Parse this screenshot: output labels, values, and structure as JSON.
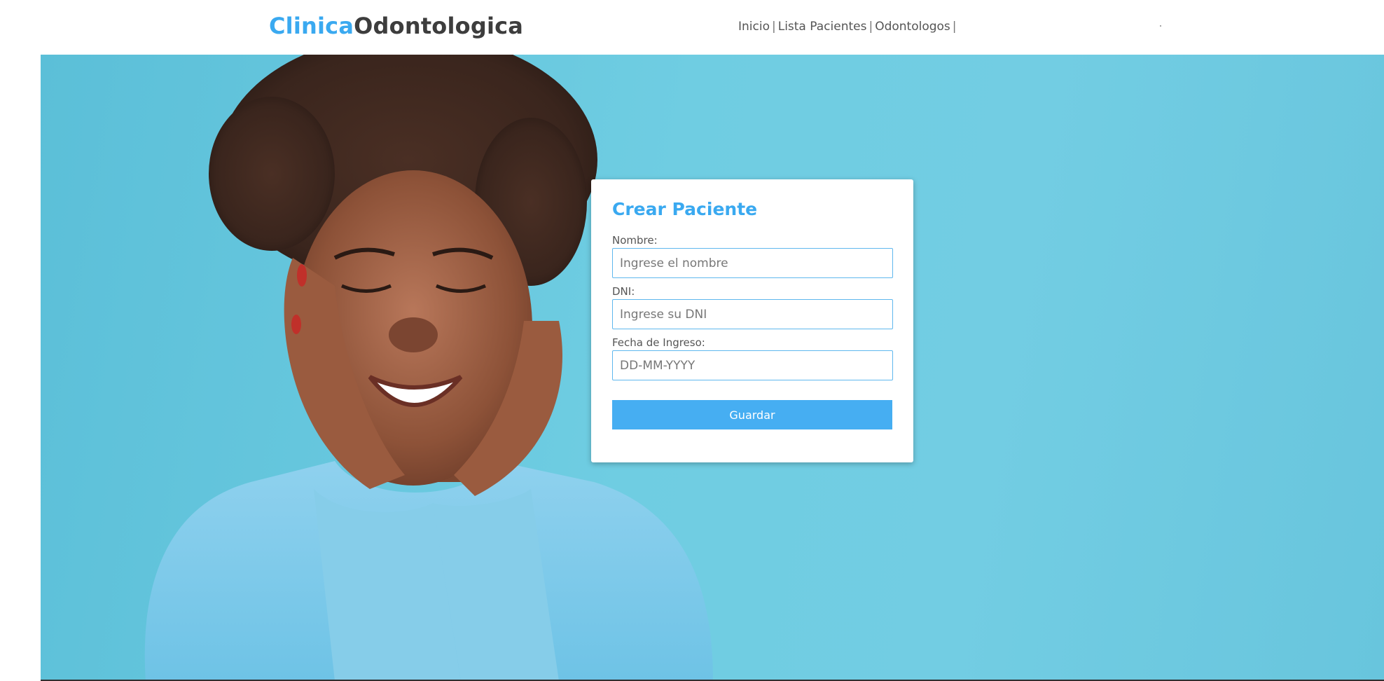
{
  "header": {
    "logo_part_a": "Clinica",
    "logo_part_b": "Odontologica",
    "nav": [
      {
        "label": "Inicio"
      },
      {
        "label": "Lista Pacientes"
      },
      {
        "label": "Odontologos"
      }
    ],
    "separator": "|"
  },
  "hero": {
    "background_color": "#6fcde2"
  },
  "form": {
    "title": "Crear Paciente",
    "fields": [
      {
        "label": "Nombre:",
        "placeholder": "Ingrese el nombre",
        "value": ""
      },
      {
        "label": "DNI:",
        "placeholder": "Ingrese su DNI",
        "value": ""
      },
      {
        "label": "Fecha de Ingreso:",
        "placeholder": "DD-MM-YYYY",
        "value": ""
      }
    ],
    "submit_label": "Guardar"
  },
  "colors": {
    "accent": "#3aa9f0",
    "button": "#46aef2",
    "logo_dark": "#3d3d3d"
  }
}
